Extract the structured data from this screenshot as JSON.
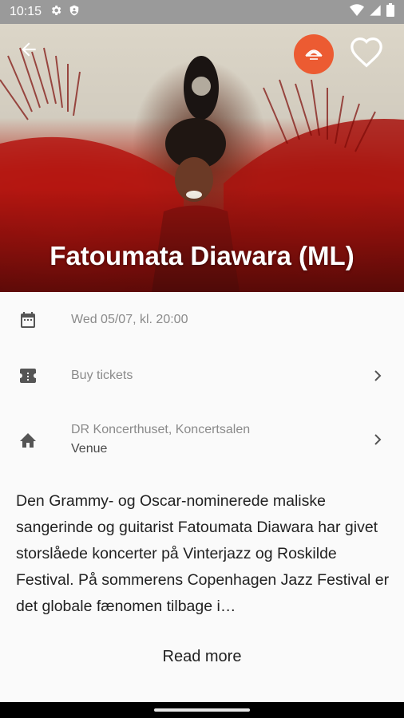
{
  "status_bar": {
    "time": "10:15",
    "left_icons": [
      "gear-icon",
      "shield-icon"
    ],
    "right_icons": [
      "wifi-icon",
      "signal-icon",
      "battery-icon"
    ]
  },
  "hero": {
    "title": "Fatoumata Diawara (ML)",
    "logo_color": "#ec5b32"
  },
  "details": {
    "date": "Wed 05/07, kl. 20:00",
    "tickets": "Buy tickets",
    "venue_name": "DR Koncerthuset, Koncertsalen",
    "venue_label": "Venue"
  },
  "description": "Den Grammy- og Oscar-nominerede maliske sangerinde og guitarist Fatoumata Diawara har givet storslåede koncerter på Vinterjazz og Roskilde Festival. På sommerens Copenhagen Jazz Festival er det globale fænomen tilbage i…",
  "read_more": "Read more"
}
